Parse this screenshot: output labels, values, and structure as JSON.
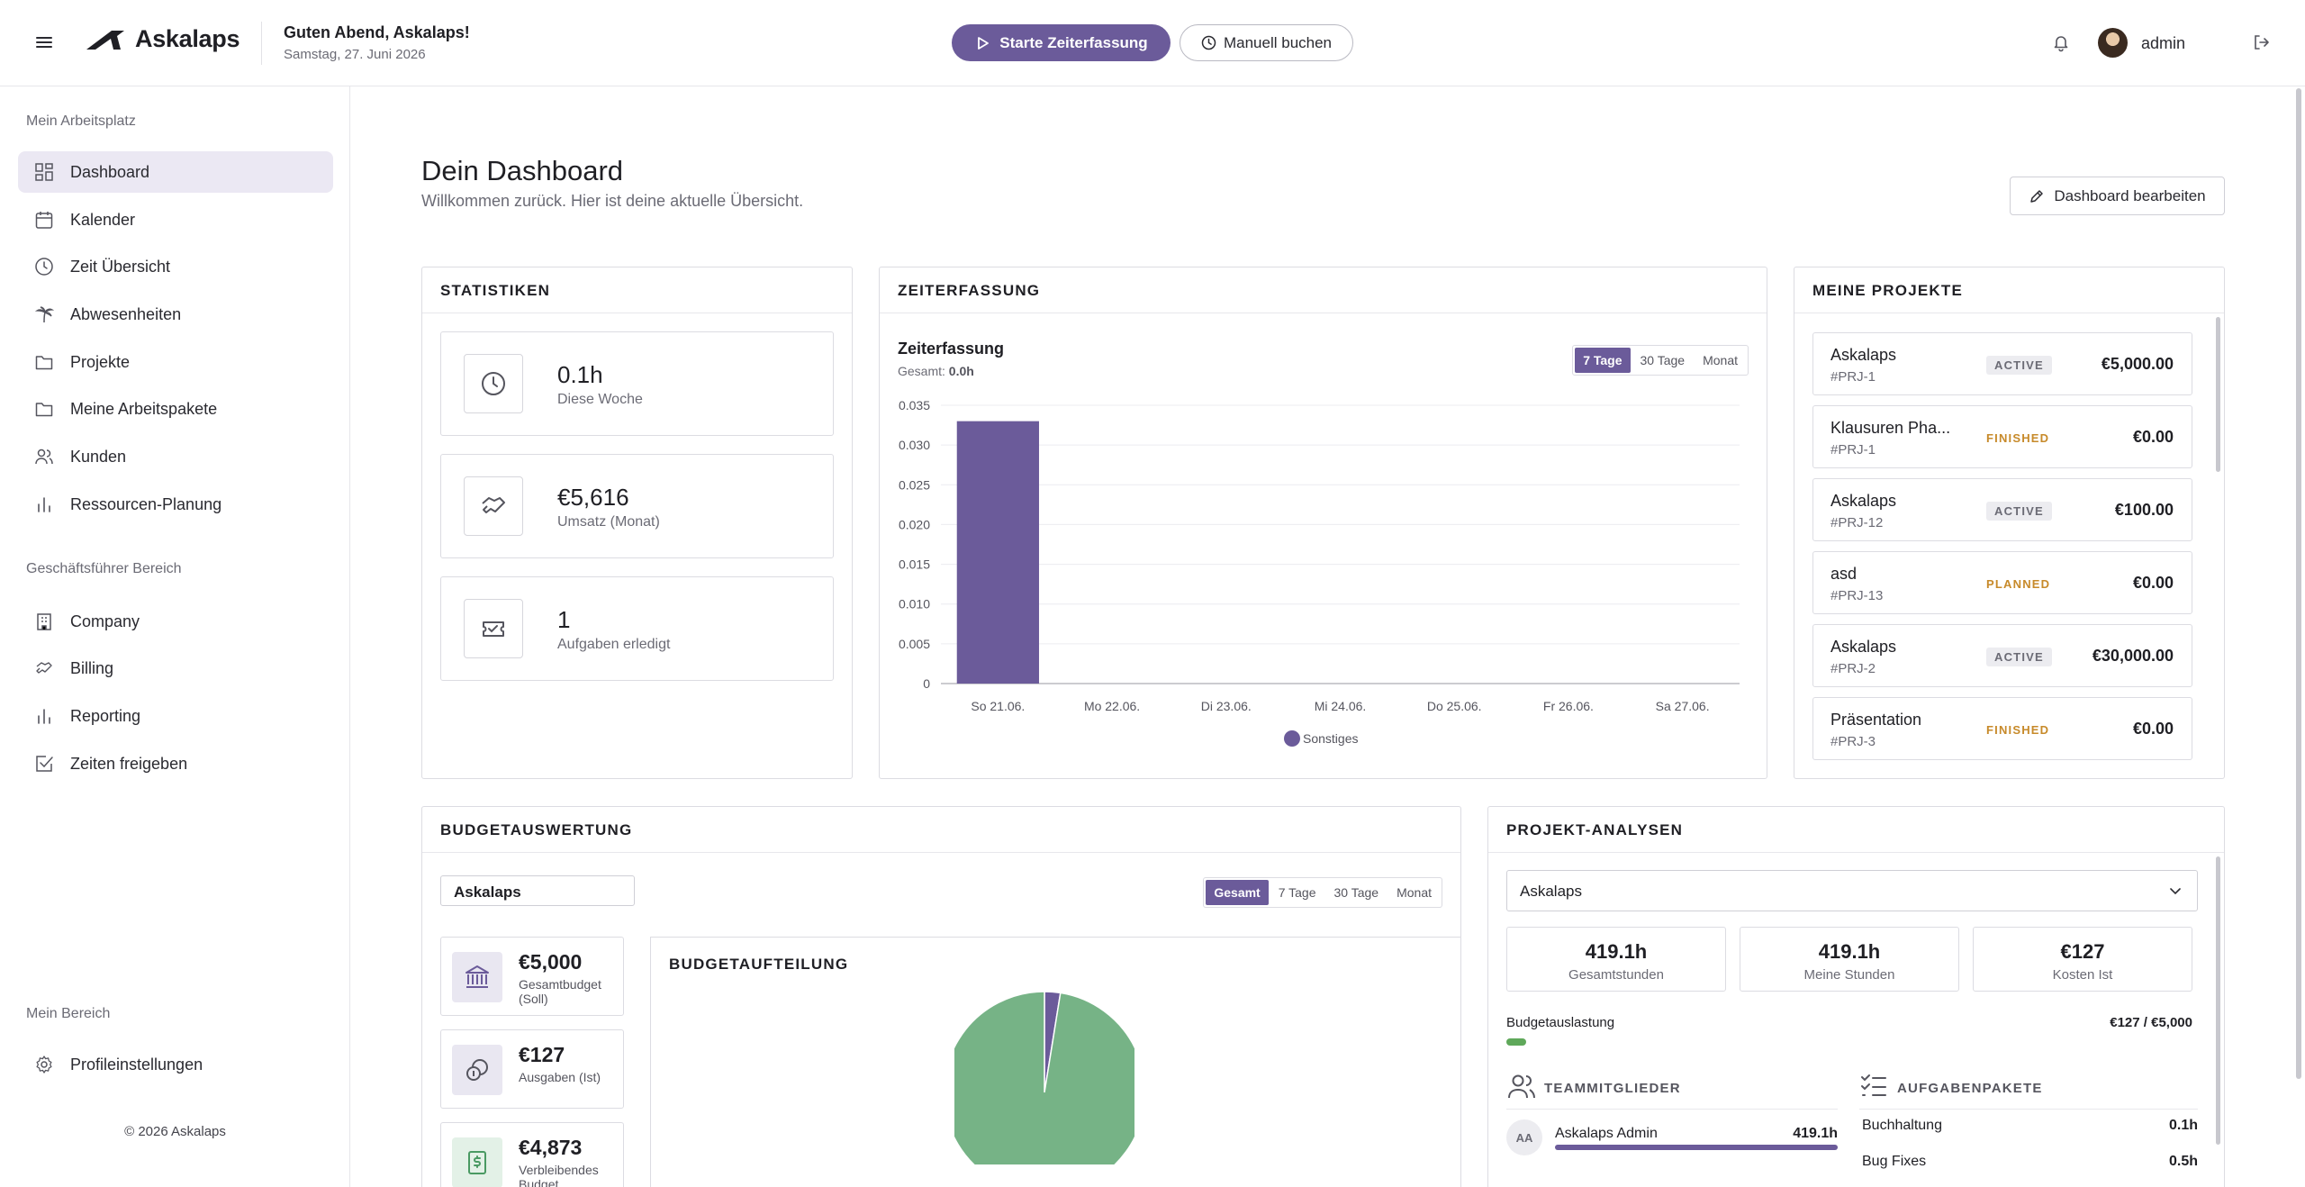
{
  "header": {
    "brand": "Askalaps",
    "greeting": "Guten Abend, Askalaps!",
    "date": "Samstag, 27. Juni 2026",
    "start_label": "Starte Zeiterfassung",
    "manual_label": "Manuell buchen",
    "user": "admin"
  },
  "sidebar": {
    "section1": "Mein Arbeitsplatz",
    "items1": [
      "Dashboard",
      "Kalender",
      "Zeit Übersicht",
      "Abwesenheiten",
      "Projekte",
      "Meine Arbeitspakete",
      "Kunden",
      "Ressourcen-Planung"
    ],
    "section2": "Geschäftsführer Bereich",
    "items2": [
      "Company",
      "Billing",
      "Reporting",
      "Zeiten freigeben"
    ],
    "section3": "Mein Bereich",
    "items3": [
      "Profileinstellungen"
    ],
    "footer": "© 2026 Askalaps"
  },
  "page": {
    "title": "Dein Dashboard",
    "subtitle": "Willkommen zurück. Hier ist deine aktuelle Übersicht.",
    "edit_label": "Dashboard bearbeiten"
  },
  "stats": {
    "title": "STATISTIKEN",
    "items": [
      {
        "value": "0.1h",
        "label": "Diese Woche",
        "icon": "clock-icon"
      },
      {
        "value": "€5,616",
        "label": "Umsatz (Monat)",
        "icon": "handshake-icon"
      },
      {
        "value": "1",
        "label": "Aufgaben erledigt",
        "icon": "ticket-icon"
      }
    ]
  },
  "zeit": {
    "title": "ZEITERFASSUNG",
    "chart_title": "Zeiterfassung",
    "total_label": "Gesamt:",
    "total_value": "0.0h",
    "ranges": [
      "7 Tage",
      "30 Tage",
      "Monat"
    ],
    "active_range": "7 Tage"
  },
  "chart_data": {
    "type": "bar",
    "categories": [
      "So 21.06.",
      "Mo 22.06.",
      "Di 23.06.",
      "Mi 24.06.",
      "Do 25.06.",
      "Fr 26.06.",
      "Sa 27.06."
    ],
    "series": [
      {
        "name": "Sonstiges",
        "values": [
          0.033,
          0,
          0,
          0,
          0,
          0,
          0
        ],
        "color": "#6b5b9a"
      }
    ],
    "yticks": [
      "0",
      "0.005",
      "0.010",
      "0.015",
      "0.020",
      "0.025",
      "0.030",
      "0.035"
    ],
    "ylim": [
      0,
      0.035
    ],
    "grid": true,
    "legend": "bottom"
  },
  "projects": {
    "title": "MEINE PROJEKTE",
    "items": [
      {
        "name": "Askalaps",
        "code": "#PRJ-1",
        "status": "ACTIVE",
        "amount": "€5,000.00"
      },
      {
        "name": "Klausuren Pha...",
        "code": "#PRJ-1",
        "status": "FINISHED",
        "amount": "€0.00"
      },
      {
        "name": "Askalaps",
        "code": "#PRJ-12",
        "status": "ACTIVE",
        "amount": "€100.00"
      },
      {
        "name": "asd",
        "code": "#PRJ-13",
        "status": "PLANNED",
        "amount": "€0.00"
      },
      {
        "name": "Askalaps",
        "code": "#PRJ-2",
        "status": "ACTIVE",
        "amount": "€30,000.00"
      },
      {
        "name": "Präsentation",
        "code": "#PRJ-3",
        "status": "FINISHED",
        "amount": "€0.00"
      }
    ]
  },
  "budget": {
    "title": "BUDGETAUSWERTUNG",
    "selected_project": "Askalaps",
    "ranges": [
      "Gesamt",
      "7 Tage",
      "30 Tage",
      "Monat"
    ],
    "active_range": "Gesamt",
    "boxes": [
      {
        "value": "€5,000",
        "label": "Gesamtbudget (Soll)",
        "icon": "bank-icon"
      },
      {
        "value": "€127",
        "label": "Ausgaben (Ist)",
        "icon": "coins-icon"
      },
      {
        "value": "€4,873",
        "label": "Verbleibendes Budget",
        "icon": "dollar-icon"
      }
    ],
    "pie_title": "BUDGETAUFTEILUNG",
    "pie": {
      "spent": 127,
      "remaining": 4873,
      "spent_color": "#6b5b9a",
      "remaining_color": "#76b386"
    }
  },
  "analysen": {
    "title": "PROJEKT-ANALYSEN",
    "selected_project": "Askalaps",
    "kpis": [
      {
        "value": "419.1h",
        "label": "Gesamtstunden"
      },
      {
        "value": "419.1h",
        "label": "Meine Stunden"
      },
      {
        "value": "€127",
        "label": "Kosten Ist"
      }
    ],
    "budget_label": "Budgetauslastung",
    "budget_value": "€127 / €5,000",
    "budget_fraction": 0.0254,
    "team_title": "TEAMMITGLIEDER",
    "team": [
      {
        "initials": "AA",
        "name": "Askalaps Admin",
        "hours": "419.1h",
        "fraction": 1.0
      }
    ],
    "packages_title": "AUFGABENPAKETE",
    "packages": [
      {
        "name": "Buchhaltung",
        "hours": "0.1h"
      },
      {
        "name": "Bug Fixes",
        "hours": "0.5h"
      }
    ]
  }
}
